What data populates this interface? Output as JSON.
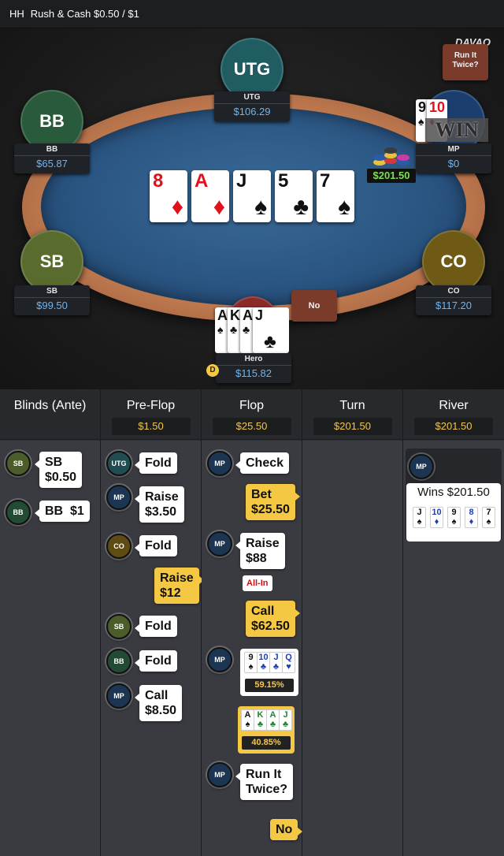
{
  "header": {
    "game_type": "HH",
    "title": "Rush & Cash $0.50 / $1"
  },
  "table": {
    "logo": "DAVAO",
    "run_it_twice_label": "Run It Twice?",
    "win_label": "WIN",
    "pot_amount": "$201.50",
    "hero_answer": "No",
    "dealer_button": "D",
    "seats": [
      {
        "pos": "UTG",
        "name": "UTG",
        "stack": "$106.29",
        "color": "#1f5d63"
      },
      {
        "pos": "BB",
        "name": "BB",
        "stack": "$65.87",
        "color": "#2a5a3c"
      },
      {
        "pos": "MP",
        "name": "MP",
        "stack": "$0",
        "color": "#1c3e6e"
      },
      {
        "pos": "SB",
        "name": "SB",
        "stack": "$99.50",
        "color": "#5a6b2e"
      },
      {
        "pos": "CO",
        "name": "CO",
        "stack": "$117.20",
        "color": "#6e5a14"
      },
      {
        "pos": "",
        "name": "Hero",
        "stack": "$115.82",
        "color": "#8c2a2a"
      }
    ],
    "board": [
      {
        "rank": "8",
        "suit": "♦",
        "color": "red"
      },
      {
        "rank": "A",
        "suit": "♦",
        "color": "red"
      },
      {
        "rank": "J",
        "suit": "♠",
        "color": "blk"
      },
      {
        "rank": "5",
        "suit": "♣",
        "color": "blk"
      },
      {
        "rank": "7",
        "suit": "♠",
        "color": "blk"
      }
    ],
    "hero_cards": [
      {
        "rank": "A",
        "suit": "♠"
      },
      {
        "rank": "K",
        "suit": "♣"
      },
      {
        "rank": "A",
        "suit": "♣"
      },
      {
        "rank": "J",
        "suit": "♣"
      }
    ],
    "mp_cards": [
      {
        "rank": "9",
        "suit": "♠"
      },
      {
        "rank": "10",
        "suit": "♦"
      },
      {
        "rank": "J",
        "suit": "♦"
      }
    ]
  },
  "history": {
    "columns": [
      {
        "title": "Blinds (Ante)",
        "pot": ""
      },
      {
        "title": "Pre-Flop",
        "pot": "$1.50"
      },
      {
        "title": "Flop",
        "pot": "$25.50"
      },
      {
        "title": "Turn",
        "pot": "$201.50"
      },
      {
        "title": "River",
        "pot": "$201.50"
      }
    ],
    "blinds": [
      {
        "chip": "SB",
        "text": "SB\n$0.50"
      },
      {
        "chip": "BB",
        "text": "BB  $1"
      }
    ],
    "preflop": [
      {
        "chip": "UTG",
        "text": "Fold"
      },
      {
        "chip": "MP",
        "text": "Raise\n$3.50"
      },
      {
        "chip": "CO",
        "text": "Fold"
      },
      {
        "hero": true,
        "text": "Raise\n$12"
      },
      {
        "chip": "SB",
        "text": "Fold"
      },
      {
        "chip": "BB",
        "text": "Fold"
      },
      {
        "chip": "MP",
        "text": "Call\n$8.50"
      }
    ],
    "flop": {
      "check": {
        "chip": "MP",
        "text": "Check"
      },
      "bet": "Bet\n$25.50",
      "raise": {
        "chip": "MP",
        "text": "Raise\n$88"
      },
      "allin": "All-In",
      "call": "Call\n$62.50",
      "mp_show": {
        "cards": [
          [
            "9",
            "♠"
          ],
          [
            "10",
            "♣"
          ],
          [
            "J",
            "♣"
          ],
          [
            "Q",
            "♥"
          ]
        ],
        "equity": "59.15%"
      },
      "hero_show": {
        "cards": [
          [
            "A",
            "♠"
          ],
          [
            "K",
            "♣"
          ],
          [
            "A",
            "♣"
          ],
          [
            "J",
            "♣"
          ]
        ],
        "equity": "40.85%"
      },
      "rit": {
        "chip": "MP",
        "text": "Run It\nTwice?"
      },
      "no": "No"
    },
    "river": {
      "chip": "MP",
      "wins": "Wins $201.50",
      "cards": [
        [
          "J",
          "♠"
        ],
        [
          "10",
          "♦"
        ],
        [
          "9",
          "♠"
        ],
        [
          "8",
          "♦"
        ],
        [
          "7",
          "♠"
        ]
      ]
    }
  },
  "colors": {
    "accent_pot": "#f3c74b",
    "stack_blue": "#6fb5ef",
    "hero_bubble": "#f4c842"
  }
}
